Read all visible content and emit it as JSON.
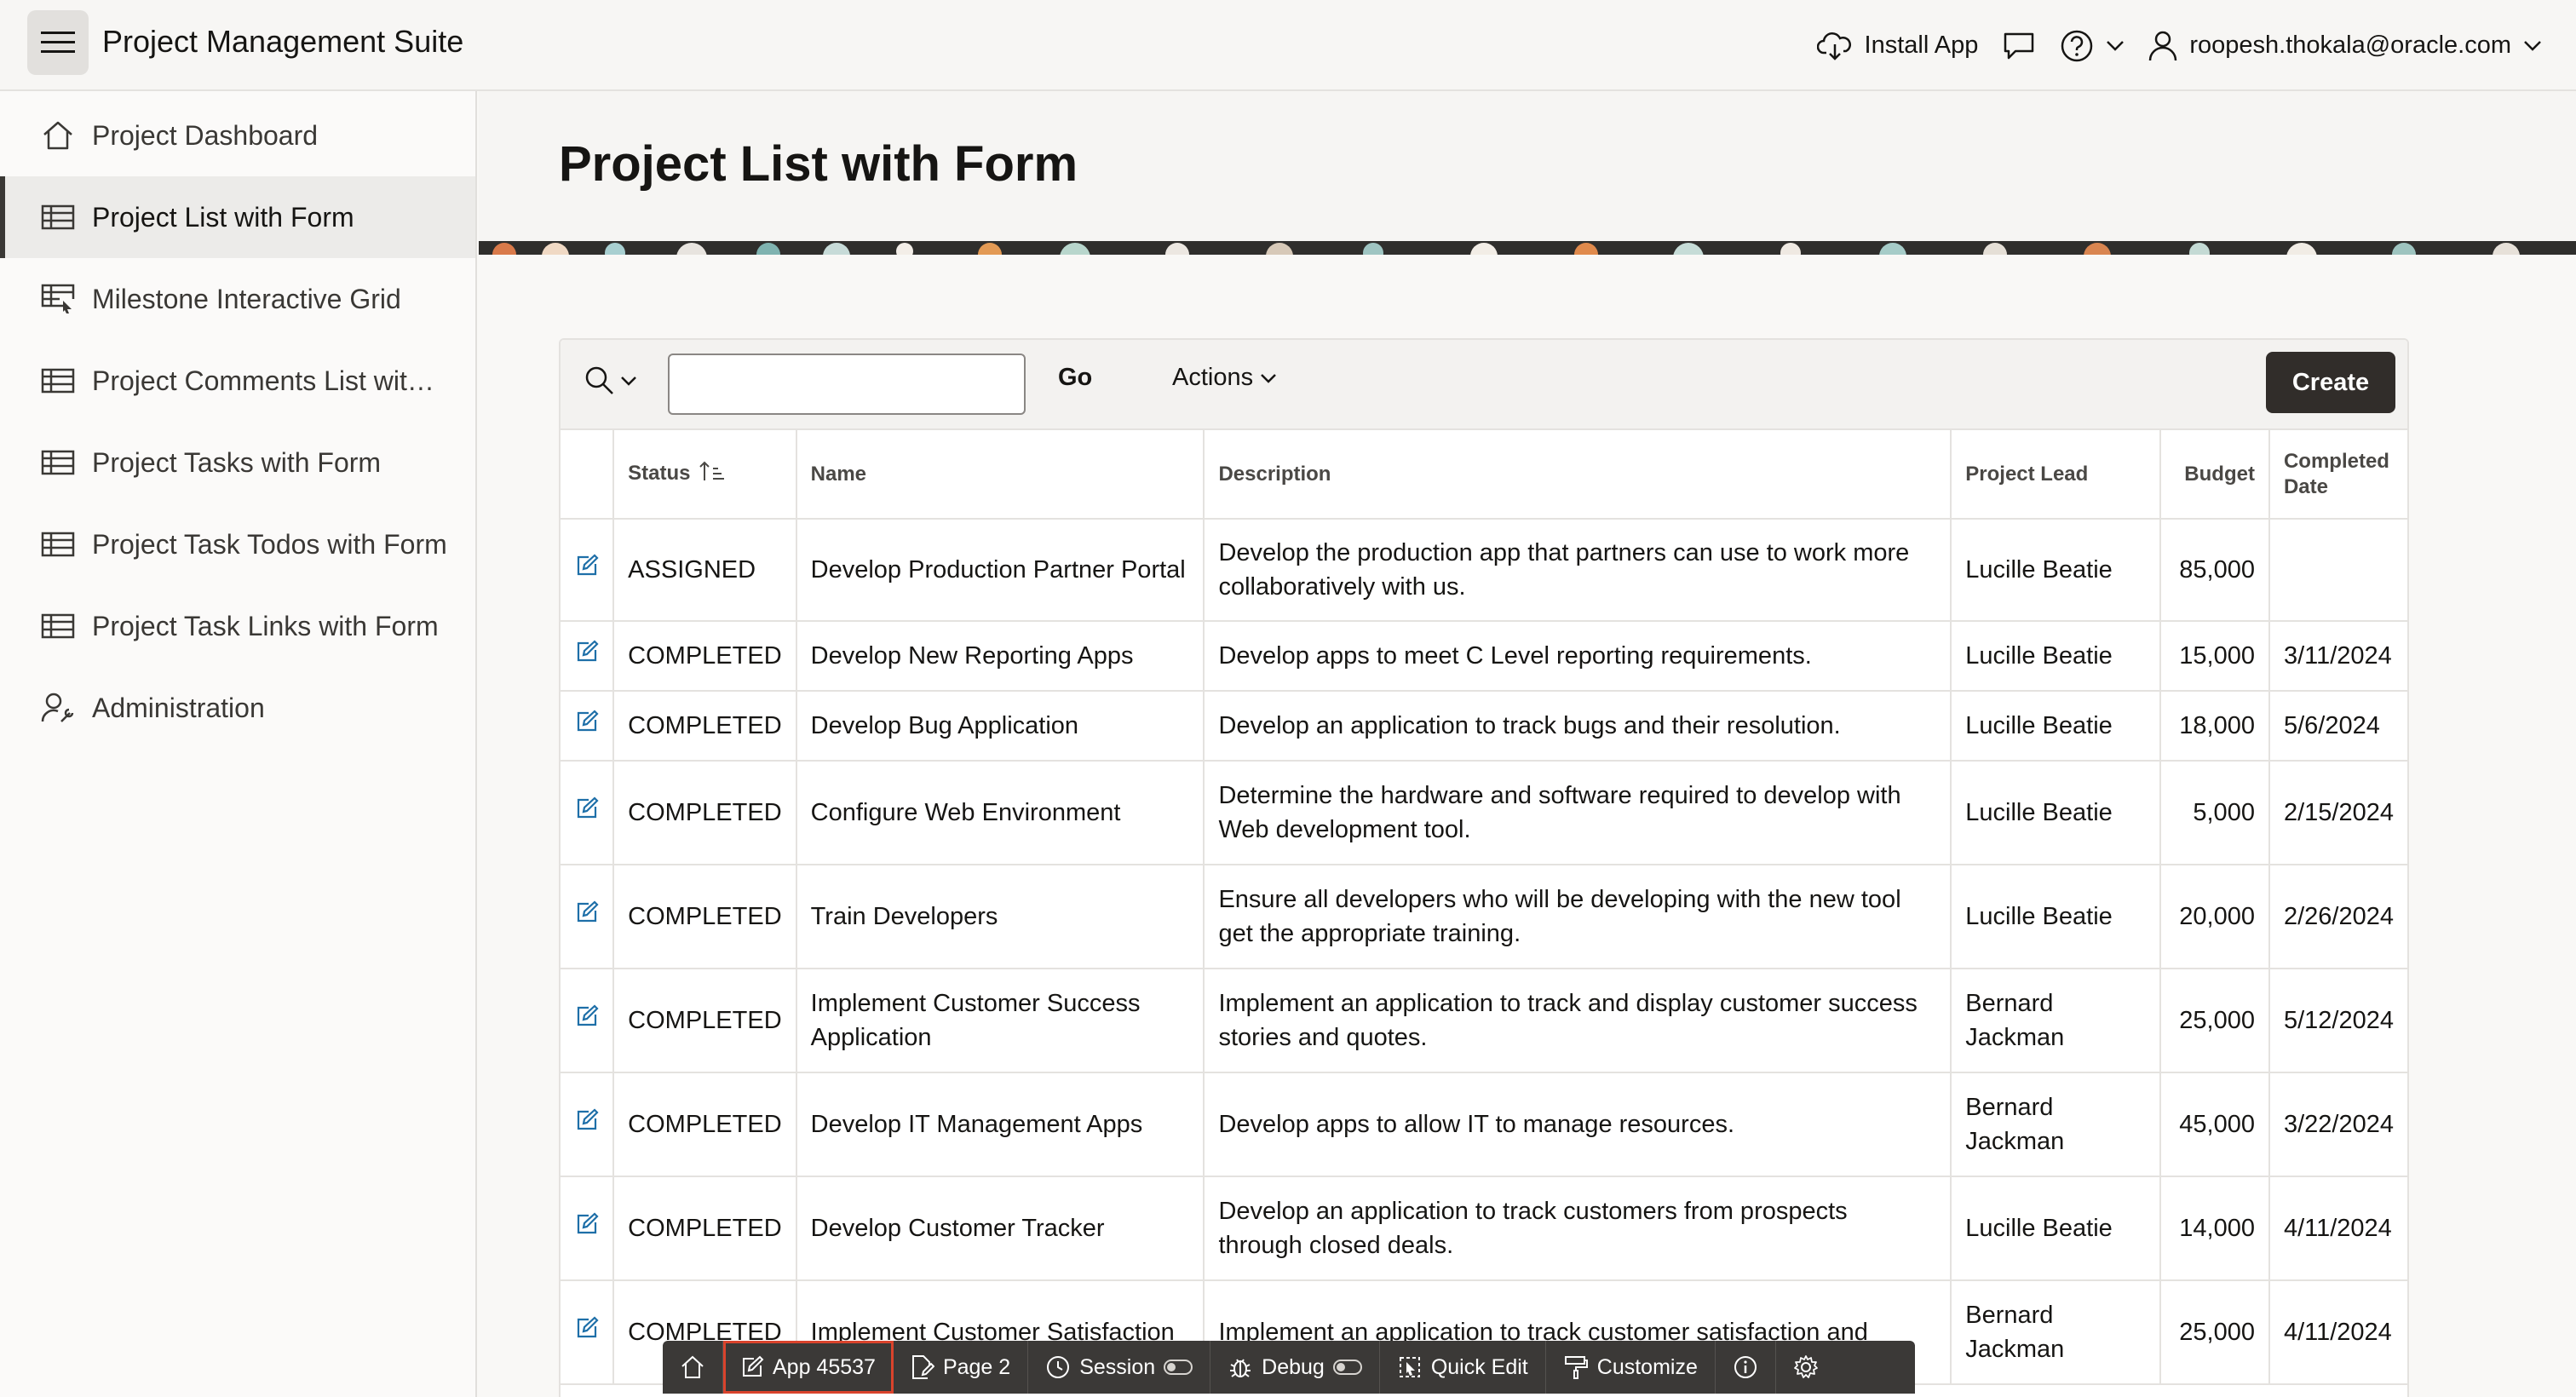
{
  "header": {
    "app_title": "Project Management Suite",
    "install_label": "Install App",
    "user_label": "roopesh.thokala@oracle.com"
  },
  "sidebar": {
    "items": [
      {
        "label": "Project Dashboard",
        "icon": "home-icon"
      },
      {
        "label": "Project List with Form",
        "icon": "table-icon",
        "active": true
      },
      {
        "label": "Milestone Interactive Grid",
        "icon": "grid-cursor-icon"
      },
      {
        "label": "Project Comments List wit…",
        "icon": "table-icon"
      },
      {
        "label": "Project Tasks with Form",
        "icon": "table-icon"
      },
      {
        "label": "Project Task Todos with Form",
        "icon": "table-icon"
      },
      {
        "label": "Project Task Links with Form",
        "icon": "table-icon"
      },
      {
        "label": "Administration",
        "icon": "user-wrench-icon"
      }
    ]
  },
  "page": {
    "title": "Project List with Form"
  },
  "toolbar": {
    "search_value": "",
    "go_label": "Go",
    "actions_label": "Actions",
    "create_label": "Create"
  },
  "table": {
    "columns": [
      "Status",
      "Name",
      "Description",
      "Project Lead",
      "Budget",
      "Completed Date"
    ],
    "rows": [
      {
        "status": "ASSIGNED",
        "name": "Develop Production Partner Portal",
        "description": "Develop the production app that partners can use to work more collaboratively with us.",
        "lead": "Lucille Beatie",
        "budget": "85,000",
        "date": ""
      },
      {
        "status": "COMPLETED",
        "name": "Develop New Reporting Apps",
        "description": "Develop apps to meet C Level reporting requirements.",
        "lead": "Lucille Beatie",
        "budget": "15,000",
        "date": "3/11/2024"
      },
      {
        "status": "COMPLETED",
        "name": "Develop Bug Application",
        "description": "Develop an application to track bugs and their resolution.",
        "lead": "Lucille Beatie",
        "budget": "18,000",
        "date": "5/6/2024"
      },
      {
        "status": "COMPLETED",
        "name": "Configure Web Environment",
        "description": "Determine the hardware and software required to develop with Web development tool.",
        "lead": "Lucille Beatie",
        "budget": "5,000",
        "date": "2/15/2024"
      },
      {
        "status": "COMPLETED",
        "name": "Train Developers",
        "description": "Ensure all developers who will be developing with the new tool get the appropriate training.",
        "lead": "Lucille Beatie",
        "budget": "20,000",
        "date": "2/26/2024"
      },
      {
        "status": "COMPLETED",
        "name": "Implement Customer Success Application",
        "description": "Implement an application to track and display customer success stories and quotes.",
        "lead": "Bernard Jackman",
        "budget": "25,000",
        "date": "5/12/2024"
      },
      {
        "status": "COMPLETED",
        "name": "Develop IT Management Apps",
        "description": "Develop apps to allow IT to manage resources.",
        "lead": "Bernard Jackman",
        "budget": "45,000",
        "date": "3/22/2024"
      },
      {
        "status": "COMPLETED",
        "name": "Develop Customer Tracker",
        "description": "Develop an application to track customers from prospects through closed deals.",
        "lead": "Lucille Beatie",
        "budget": "14,000",
        "date": "4/11/2024"
      },
      {
        "status": "COMPLETED",
        "name": "Implement Customer Satisfaction",
        "description": "Implement an application to track customer satisfaction and",
        "lead": "Bernard Jackman",
        "budget": "25,000",
        "date": "4/11/2024"
      }
    ]
  },
  "devbar": {
    "app_label": "App 45537",
    "page_label": "Page 2",
    "session_label": "Session",
    "debug_label": "Debug",
    "quick_edit_label": "Quick Edit",
    "customize_label": "Customize"
  },
  "colors": {
    "create_button": "#312d2a",
    "devbar": "#3b3937",
    "edit_icon": "#1e6fa8",
    "highlight": "#d9432c"
  }
}
